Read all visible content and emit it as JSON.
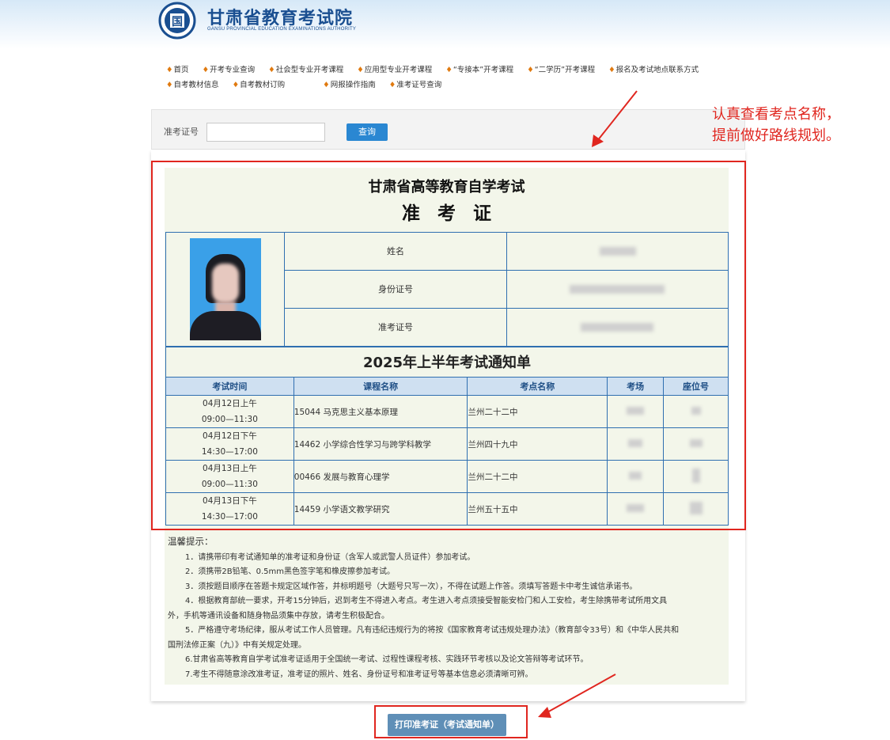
{
  "header": {
    "logo_cn": "甘肃省教育考试院",
    "logo_en": "GANSU PROVINCIAL EDUCATION EXAMINATIONS AUTHORITY",
    "emblem_char": "国"
  },
  "nav": {
    "row1": [
      "首页",
      "开考专业查询",
      "社会型专业开考课程",
      "应用型专业开考课程",
      "“专接本”开考课程",
      "“二学历”开考课程",
      "报名及考试地点联系方式"
    ],
    "row2": [
      "自考教材信息",
      "自考教材订购",
      "网报操作指南",
      "准考证号查询"
    ]
  },
  "search": {
    "label": "准考证号",
    "value": "",
    "button": "查询"
  },
  "annotation": {
    "line1": "认真查看考点名称，",
    "line2": "提前做好路线规划。"
  },
  "card": {
    "title": "甘肃省高等教育自学考试",
    "subtitle": "准考证",
    "info_labels": [
      "姓名",
      "身份证号",
      "准考证号"
    ]
  },
  "notice": {
    "title": "2025年上半年考试通知单",
    "headers": [
      "考试时间",
      "课程名称",
      "考点名称",
      "考场",
      "座位号"
    ],
    "rows": [
      {
        "date": "04月12日上午",
        "time": "09:00—11:30",
        "course": "15044 马克思主义基本原理",
        "site": "兰州二十二中"
      },
      {
        "date": "04月12日下午",
        "time": "14:30—17:00",
        "course": "14462 小学综合性学习与跨学科教学",
        "site": "兰州四十九中"
      },
      {
        "date": "04月13日上午",
        "time": "09:00—11:30",
        "course": "00466 发展与教育心理学",
        "site": "兰州二十二中"
      },
      {
        "date": "04月13日下午",
        "time": "14:30—17:00",
        "course": "14459 小学语文教学研究",
        "site": "兰州五十五中"
      }
    ]
  },
  "tips": {
    "heading": "温馨提示：",
    "items": [
      "1．请携带印有考试通知单的准考证和身份证（含军人或武警人员证件）参加考试。",
      "2．须携带2B铅笔、0.5mm黑色签字笔和橡皮擦参加考试。",
      "3．须按题目顺序在答题卡规定区域作答，并标明题号（大题号只写一次），不得在试题上作答。须填写答题卡中考生诚信承诺书。",
      "4．根据教育部统一要求，开考15分钟后，迟到考生不得进入考点。考生进入考点须接受智能安检门和人工安检，考生除携带考试所用文具外，手机等通讯设备和随身物品须集中存放，请考生积极配合。",
      "5．严格遵守考场纪律，服从考试工作人员管理。凡有违纪违规行为的将按《国家教育考试违规处理办法》（教育部令33号）和《中华人民共和国刑法修正案（九）》中有关规定处理。",
      "6.甘肃省高等教育自学考试准考证适用于全国统一考试、过程性课程考核、实践环节考核以及论文答辩等考试环节。",
      "7.考生不得随意涂改准考证，准考证的照片、姓名、身份证号和准考证号等基本信息必须清晰可辨。"
    ]
  },
  "print_button": "打印准考证（考试通知单）",
  "colors": {
    "accent_blue": "#2a87d2",
    "table_border": "#2f6fb0",
    "card_bg": "#f3f6ea",
    "annotation_red": "#e0261f"
  }
}
